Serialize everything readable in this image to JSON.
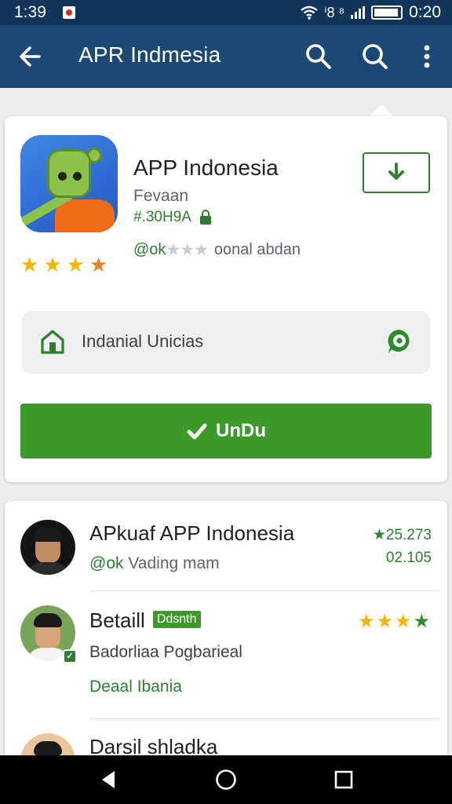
{
  "status_bar": {
    "time": "1:39",
    "right_text": "ⁱ8 ⁸",
    "battery_time": "0:20"
  },
  "app_bar": {
    "title": "APR Indmesia",
    "back_icon": "arrow-left-icon",
    "search_icon": "search-icon",
    "more_icon": "more-vert-icon"
  },
  "app": {
    "name": "APP Indonesia",
    "developer": "Fevaan",
    "meta": "#.30H9A",
    "rating_prefix": "@ok",
    "rating_stars": "★★★",
    "rating_desc": "oonal abdan",
    "stars": 4,
    "download_icon": "download-icon"
  },
  "info_box": {
    "label": "Indanial Unicias",
    "home_icon": "home-icon",
    "chat_icon": "chat-icon"
  },
  "install": {
    "label": "UnDu",
    "icon": "check-tag-icon"
  },
  "reviews": [
    {
      "name": "APkuaf APP Indonesia",
      "sub_prefix": "@ok",
      "sub_text": "Vading mam",
      "rating_text": "★25.273",
      "count": "02.105"
    },
    {
      "name": "Betaill",
      "badge": "Ddsnth",
      "stars": 4,
      "body": "Badorliaa Pogbarieal",
      "link": "Deaal Ibania"
    },
    {
      "name": "Darsil shladka"
    }
  ],
  "colors": {
    "app_bar": "#1b4874",
    "status_bar": "#12355b",
    "accent_green": "#3c9a2b",
    "text_green": "#2e7d32"
  }
}
